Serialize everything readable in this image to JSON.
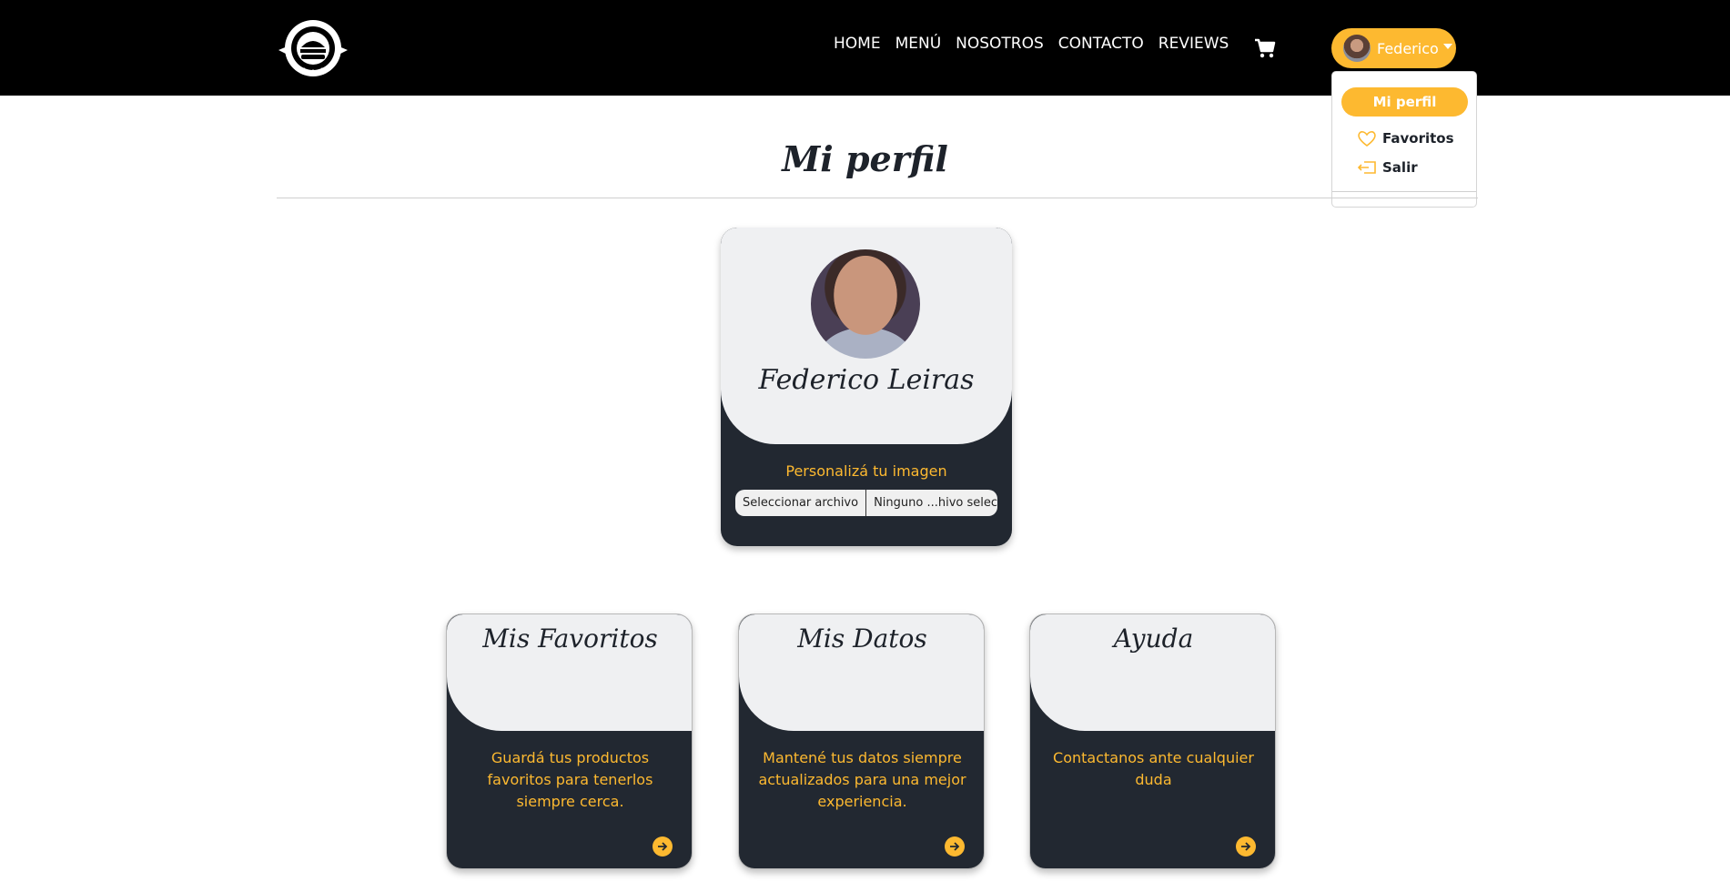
{
  "nav": {
    "links": [
      "HOME",
      "MENÚ",
      "NOSOTROS",
      "CONTACTO",
      "REVIEWS"
    ],
    "user_label": "Federico"
  },
  "dropdown": {
    "active": "Mi perfil",
    "favorites": "Favoritos",
    "logout": "Salir"
  },
  "page": {
    "title": "Mi perfil"
  },
  "profile": {
    "name": "Federico Leiras",
    "customize_label": "Personalizá tu imagen",
    "file_button": "Seleccionar archivo",
    "file_status": "Ninguno ...hivo selec."
  },
  "cards": [
    {
      "title": "Mis Favoritos",
      "description": "Guardá tus productos favoritos para tenerlos siempre cerca."
    },
    {
      "title": "Mis Datos",
      "description": "Mantené tus datos siempre actualizados para una mejor experiencia."
    },
    {
      "title": "Ayuda",
      "description": "Contactanos ante cualquier duda"
    }
  ],
  "colors": {
    "accent": "#fdb930",
    "dark": "#222831",
    "light": "#eff0f2",
    "navbar": "#000000"
  },
  "icons": [
    "logo-icon",
    "cart-icon",
    "heart-icon",
    "logout-icon",
    "arrow-right-icon"
  ]
}
